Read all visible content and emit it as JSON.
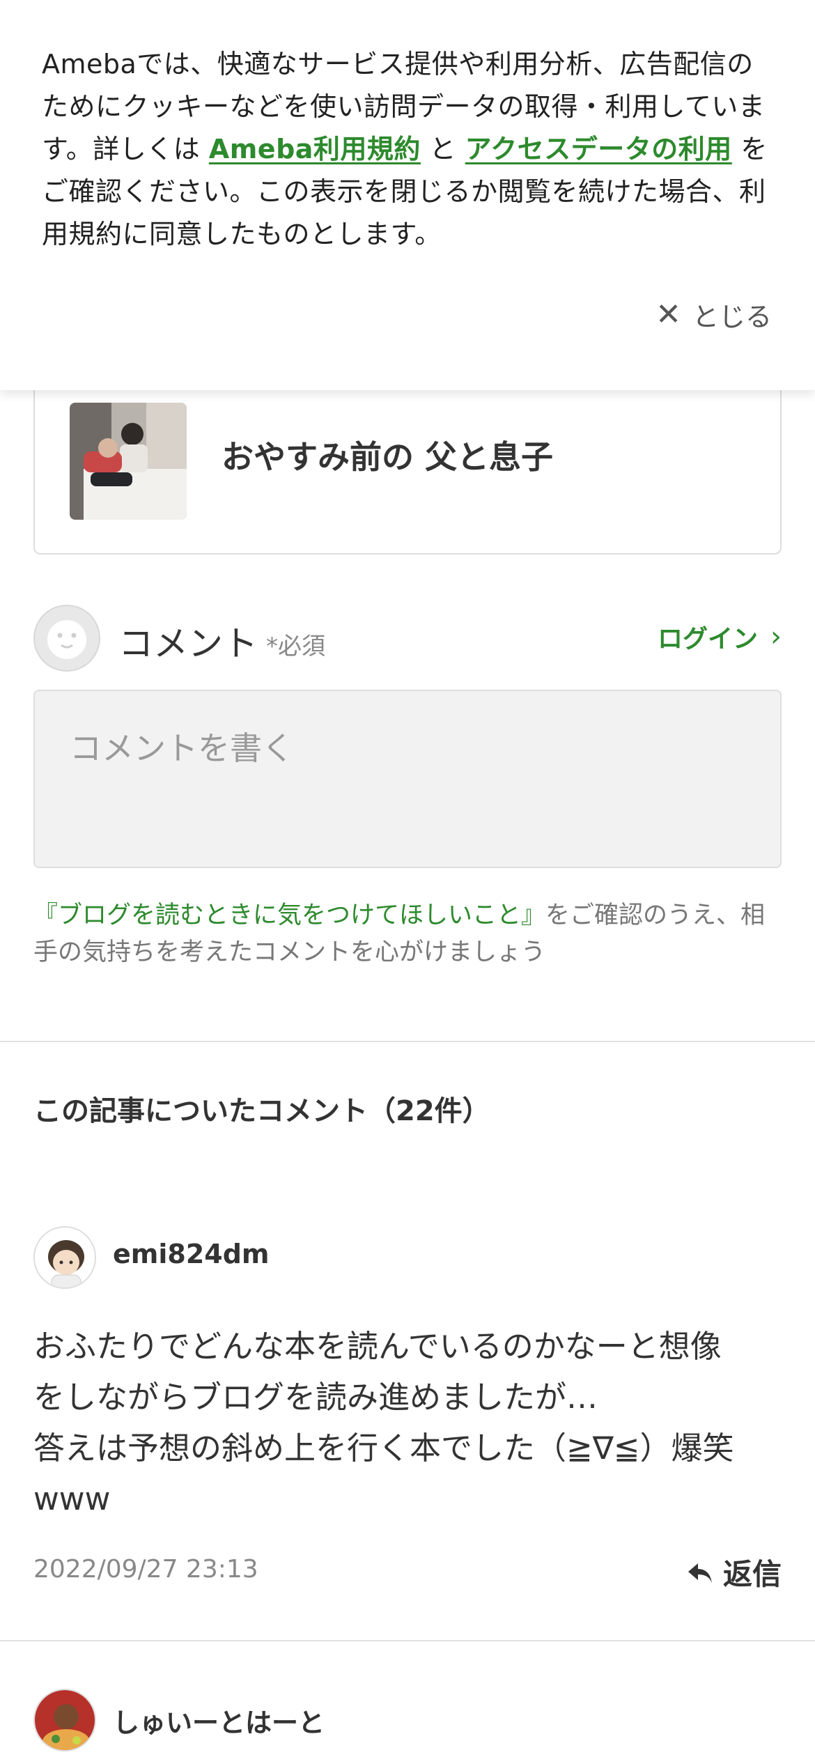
{
  "cookie_banner": {
    "text_1": "Amebaでは、快適なサービス提供や利用分析、広告配信のためにクッキーなどを使い訪問データの取得・利用しています。詳しくは",
    "link_terms": "Ameba利用規約",
    "text_2": "と",
    "link_access": "アクセスデータの利用",
    "text_3": "をご確認ください。この表示を閉じるか閲覧を続けた場合、利用規約に同意したものとします。",
    "close_label": "とじる"
  },
  "article": {
    "title": "おやすみ前の 父と息子"
  },
  "comment_form": {
    "label": "コメント",
    "required": "*必須",
    "login_label": "ログイン",
    "placeholder": "コメントを書く",
    "guideline_link": "『ブログを読むときに気をつけてほしいこと』",
    "guideline_text": "をご確認のうえ、相手の気持ちを考えたコメントを心がけましょう"
  },
  "comments_section": {
    "title": "この記事についたコメント（22件）",
    "comments": [
      {
        "author": "emi824dm",
        "body_lines": [
          "おふたりでどんな本を読んでいるのかなーと想像",
          "をしながらブログを読み進めましたが…",
          "答えは予想の斜め上を行く本でした（≧∇≦）爆笑",
          "www"
        ],
        "date": "2022/09/27 23:13",
        "reply_label": "返信"
      },
      {
        "author": "しゅいーとはーと"
      }
    ]
  },
  "colors": {
    "accent_green": "#2d8a2d",
    "text": "#333333",
    "muted": "#888888"
  },
  "icons": [
    "close-icon",
    "chevron-right-icon",
    "default-avatar-icon",
    "reply-icon"
  ]
}
